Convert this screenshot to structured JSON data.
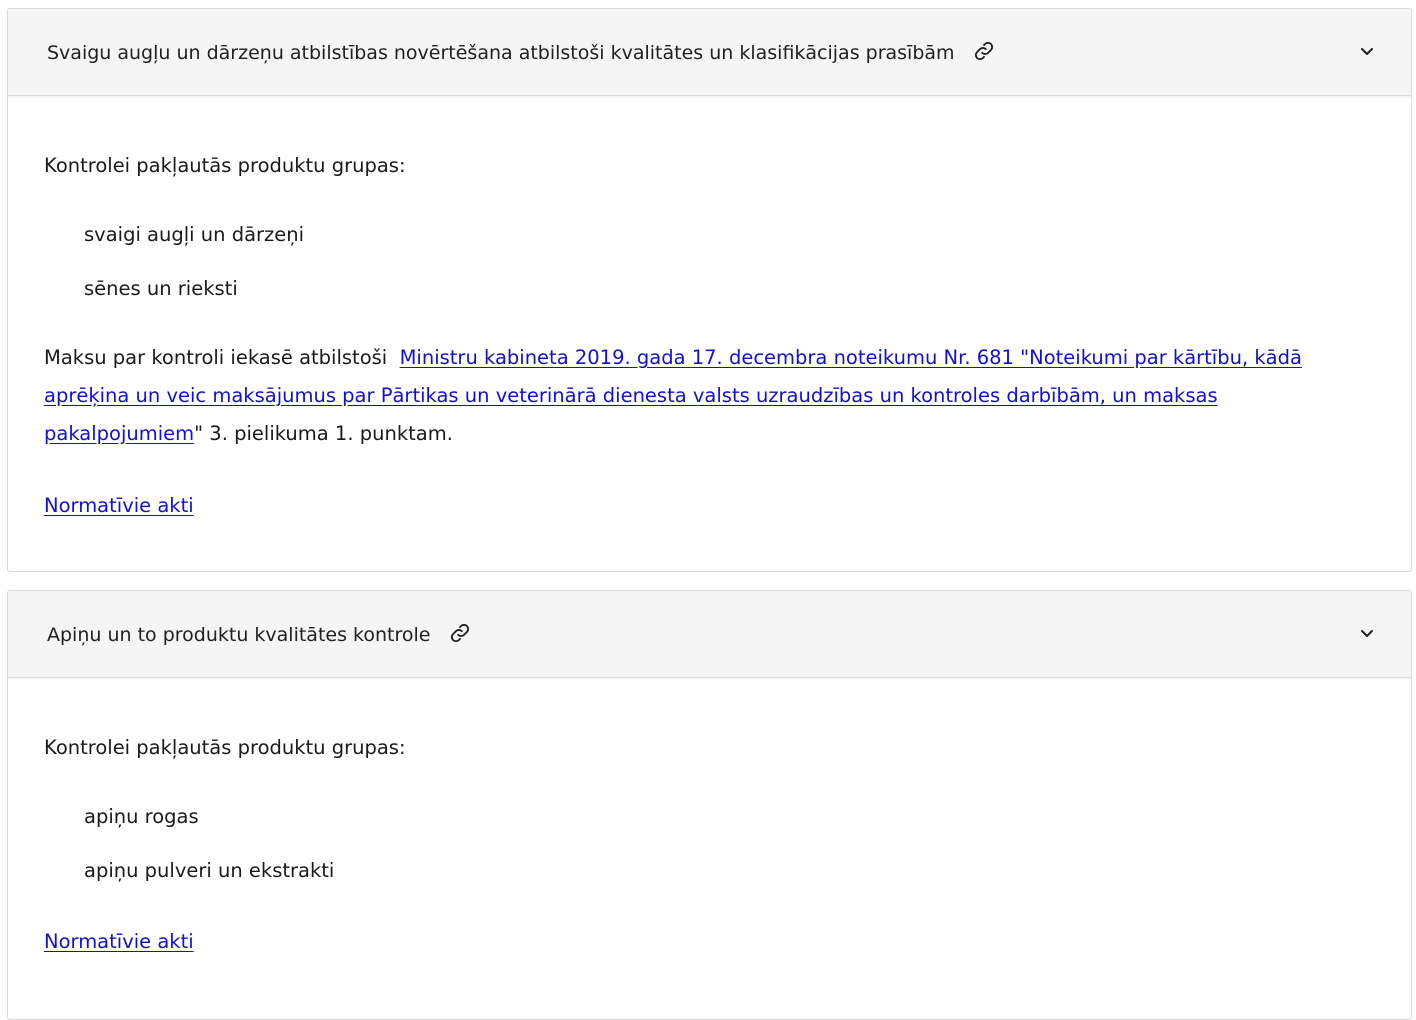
{
  "sections": [
    {
      "title": "Svaigu augļu un dārzeņu atbilstības novērtēšana atbilstoši kvalitātes un klasifikācijas prasībām",
      "intro": "Kontrolei pakļautās produktu grupas:",
      "items": [
        "svaigi augļi un dārzeņi",
        "sēnes un rieksti"
      ],
      "fee": {
        "prefix": "Maksu par kontroli iekasē atbilstoši",
        "link_text": "Ministru kabineta 2019. gada 17. decembra noteikumu Nr. 681 \"Noteikumi par kārtību, kādā aprēķina un veic maksājumus par Pārtikas un veterinārā dienesta valsts uzraudzības un kontroles darbībām, un maksas pakalpojumiem",
        "suffix": "\" 3. pielikuma 1. punktam."
      },
      "legal_link": "Normatīvie akti"
    },
    {
      "title": "Apiņu un to produktu kvalitātes kontrole",
      "intro": "Kontrolei pakļautās produktu grupas:",
      "items": [
        "apiņu rogas",
        "apiņu pulveri un ekstrakti"
      ],
      "legal_link": "Normatīvie akti"
    }
  ],
  "icons": {
    "link": "link-icon",
    "expand": "chevron-down-icon"
  },
  "colors": {
    "link": "#1111cc",
    "header_bg": "#f5f5f5",
    "border": "#d9d9d9"
  }
}
